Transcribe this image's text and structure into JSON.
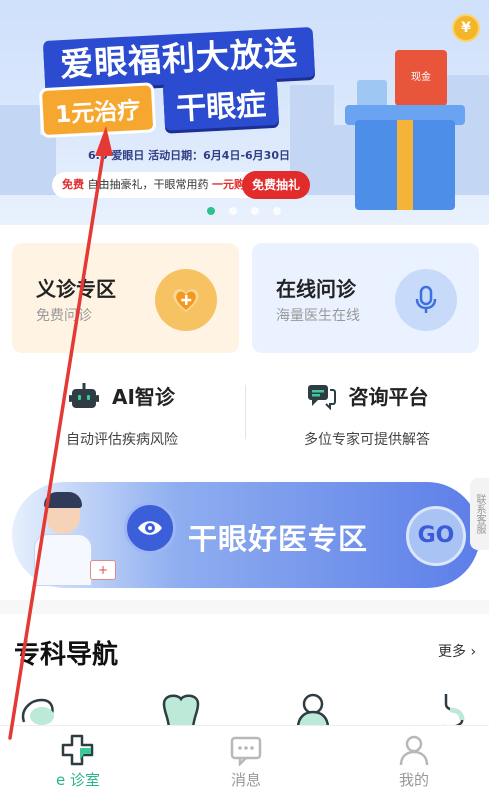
{
  "banner": {
    "title": "爱眼福利大放送",
    "subtitle_pill": "1元治疗",
    "subtitle_main": "干眼症",
    "dates": "6.6 爱眼日    活动日期：6月4日-6月30日",
    "promo_free": "免费",
    "promo_text": "自由抽豪礼，干眼常用药",
    "promo_price": "一元购",
    "promo_button": "免费抽礼",
    "box_label": "现金",
    "coin_symbol": "¥",
    "colors": {
      "title_bg": "#2b4cd0",
      "pill_bg": "#f6a72f",
      "promo_red": "#e22b2b"
    }
  },
  "cards": [
    {
      "title": "义诊专区",
      "subtitle": "免费问诊",
      "icon": "heart-plus-icon",
      "color": "#f7c262"
    },
    {
      "title": "在线问诊",
      "subtitle": "海量医生在线",
      "icon": "microphone-icon",
      "color": "#c7dafa"
    }
  ],
  "features": [
    {
      "title": "AI智诊",
      "subtitle": "自动评估疾病风险",
      "icon": "robot-icon"
    },
    {
      "title": "咨询平台",
      "subtitle": "多位专家可提供解答",
      "icon": "chat-bubbles-icon"
    }
  ],
  "promo": {
    "title": "干眼好医专区",
    "go": "GO",
    "side_tab": "联系客服"
  },
  "specialty": {
    "title": "专科导航",
    "more": "更多 ›"
  },
  "tabs": [
    {
      "label": "e 诊室",
      "icon": "clinic-cross-icon",
      "active": true
    },
    {
      "label": "消息",
      "icon": "message-icon",
      "active": false
    },
    {
      "label": "我的",
      "icon": "person-icon",
      "active": false
    }
  ],
  "accent_color": "#2ab48b"
}
